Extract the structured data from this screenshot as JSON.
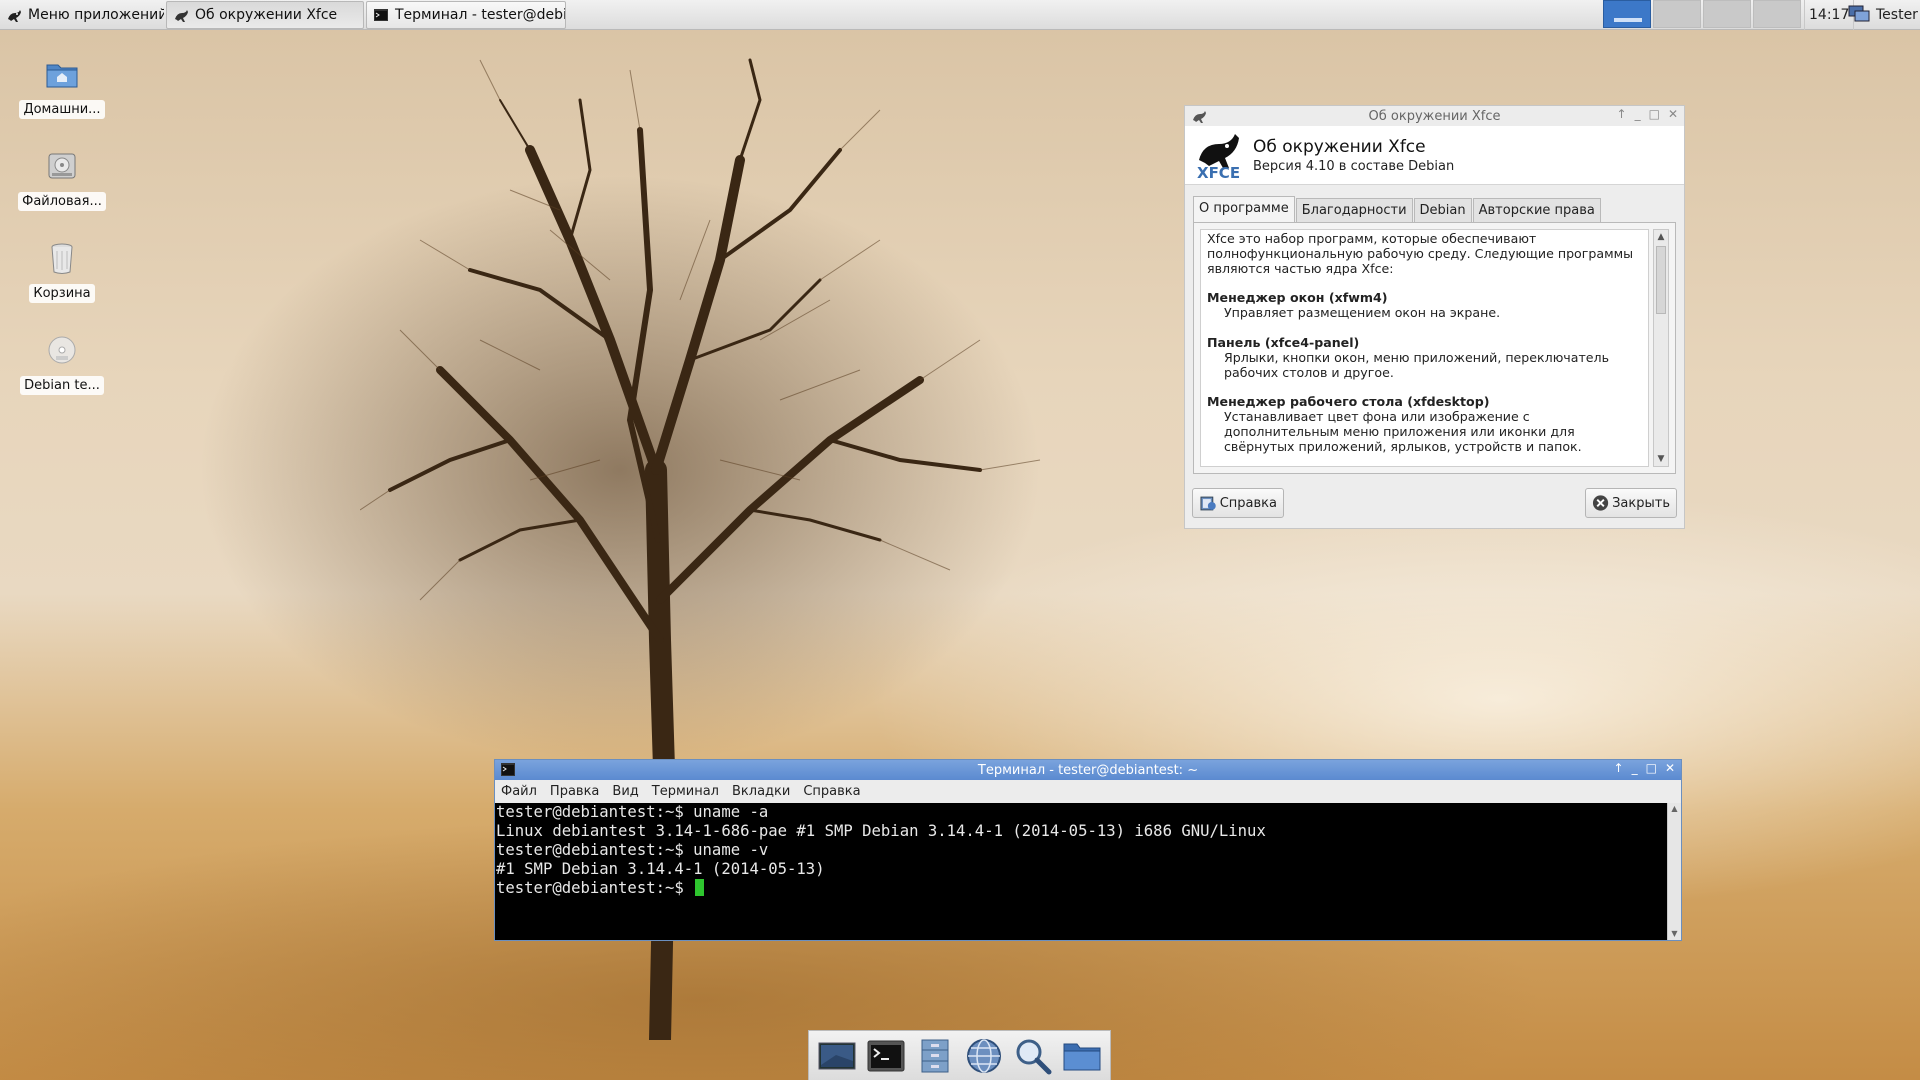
{
  "top_panel": {
    "apps_menu_label": "Меню приложений",
    "tasks": [
      {
        "label": "Об окружении Xfce",
        "active": true
      },
      {
        "label": "Терминал - tester@debi...",
        "active": false
      }
    ],
    "workspaces_count": 4,
    "active_workspace": 1,
    "clock": "14:17",
    "user": "Tester"
  },
  "desktop_icons": [
    {
      "label": "Домашни...",
      "icon": "home-folder-icon"
    },
    {
      "label": "Файловая...",
      "icon": "filesystem-drive-icon"
    },
    {
      "label": "Корзина",
      "icon": "trash-icon"
    },
    {
      "label": "Debian te...",
      "icon": "dvd-disc-icon"
    }
  ],
  "about_window": {
    "title": "Об окружении Xfce",
    "heading": "Об окружении Xfce",
    "version": "Версия 4.10 в составе Debian",
    "tabs": [
      "О программе",
      "Благодарности",
      "Debian",
      "Авторские права"
    ],
    "active_tab": 0,
    "intro": "Xfce это набор программ, которые обеспечивают полнофункциональную рабочую среду. Следующие программы являются частью ядра Xfce:",
    "components": [
      {
        "name": "Менеджер окон (xfwm4)",
        "desc": "Управляет размещением окон на экране."
      },
      {
        "name": "Панель (xfce4-panel)",
        "desc": "Ярлыки, кнопки окон, меню приложений, переключатель рабочих столов и другое."
      },
      {
        "name": "Менеджер рабочего стола (xfdesktop)",
        "desc": "Устанавливает цвет фона или изображение с дополнительным меню приложения или иконки для свёрнутых приложений, ярлыков, устройств и папок."
      }
    ],
    "help_button": "Справка",
    "close_button": "Закрыть"
  },
  "terminal_window": {
    "title": "Терминал - tester@debiantest: ~",
    "menu": [
      "Файл",
      "Правка",
      "Вид",
      "Терминал",
      "Вкладки",
      "Справка"
    ],
    "lines": [
      "tester@debiantest:~$ uname -a",
      "Linux debiantest 3.14-1-686-pae #1 SMP Debian 3.14.4-1 (2014-05-13) i686 GNU/Linux",
      "tester@debiantest:~$ uname -v",
      "#1 SMP Debian 3.14.4-1 (2014-05-13)"
    ],
    "prompt": "tester@debiantest:~$ "
  },
  "dock": {
    "items": [
      "show-desktop-icon",
      "terminal-icon",
      "file-manager-icon",
      "web-browser-icon",
      "search-icon",
      "folder-icon"
    ]
  },
  "colors": {
    "active_workspace": "#3c78c8",
    "terminal_titlebar": "#6a97d6",
    "terminal_cursor": "#2ec52e"
  }
}
